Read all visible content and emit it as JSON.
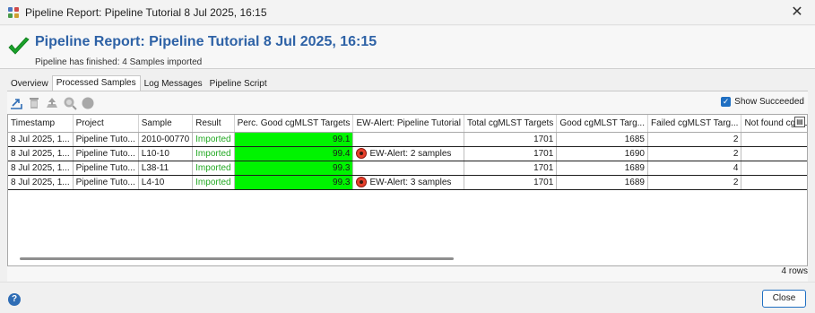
{
  "window": {
    "title": "Pipeline Report: Pipeline Tutorial 8 Jul 2025, 16:15",
    "close_glyph": "✕",
    "icon": "app-grid-icon"
  },
  "header": {
    "heading": "Pipeline Report: Pipeline Tutorial 8 Jul 2025, 16:15",
    "status": "Pipeline has finished: 4 Samples imported",
    "status_icon": "green-check-icon",
    "heading_color": "#2e62a6"
  },
  "tabs": [
    {
      "label": "Overview",
      "active": false
    },
    {
      "label": "Processed Samples",
      "active": true
    },
    {
      "label": "Log Messages",
      "active": false
    },
    {
      "label": "Pipeline Script",
      "active": false
    }
  ],
  "toolbar": {
    "icons": [
      "export-icon",
      "delete-icon",
      "upload-icon",
      "search-icon",
      "stop-icon"
    ]
  },
  "show_succeeded": {
    "label": "Show Succeeded",
    "checked": true
  },
  "table": {
    "columns": [
      "Timestamp",
      "Project",
      "Sample",
      "Result",
      "Perc. Good cgMLST Targets",
      "EW-Alert: Pipeline Tutorial",
      "Total cgMLST Targets",
      "Good cgMLST Targ...",
      "Failed cgMLST Targ...",
      "Not found cgML"
    ],
    "rows": [
      {
        "timestamp": "8 Jul 2025, 1...",
        "project": "Pipeline Tuto...",
        "sample": "2010-00770",
        "result": "Imported",
        "perc_good": "99.1",
        "ew_alert": "",
        "total": "1701",
        "good": "1685",
        "failed": "2",
        "not_found": ""
      },
      {
        "timestamp": "8 Jul 2025, 1...",
        "project": "Pipeline Tuto...",
        "sample": "L10-10",
        "result": "Imported",
        "perc_good": "99.4",
        "ew_alert": "EW-Alert: 2 samples",
        "total": "1701",
        "good": "1690",
        "failed": "2",
        "not_found": ""
      },
      {
        "timestamp": "8 Jul 2025, 1...",
        "project": "Pipeline Tuto...",
        "sample": "L38-11",
        "result": "Imported",
        "perc_good": "99.3",
        "ew_alert": "",
        "total": "1701",
        "good": "1689",
        "failed": "4",
        "not_found": ""
      },
      {
        "timestamp": "8 Jul 2025, 1...",
        "project": "Pipeline Tuto...",
        "sample": "L4-10",
        "result": "Imported",
        "perc_good": "99.3",
        "ew_alert": "EW-Alert: 3 samples",
        "total": "1701",
        "good": "1689",
        "failed": "2",
        "not_found": ""
      }
    ],
    "highlight_color": "#00f400",
    "imported_color": "#21a821"
  },
  "row_count": "4 rows",
  "footer": {
    "help_glyph": "?",
    "close_label": "Close"
  }
}
